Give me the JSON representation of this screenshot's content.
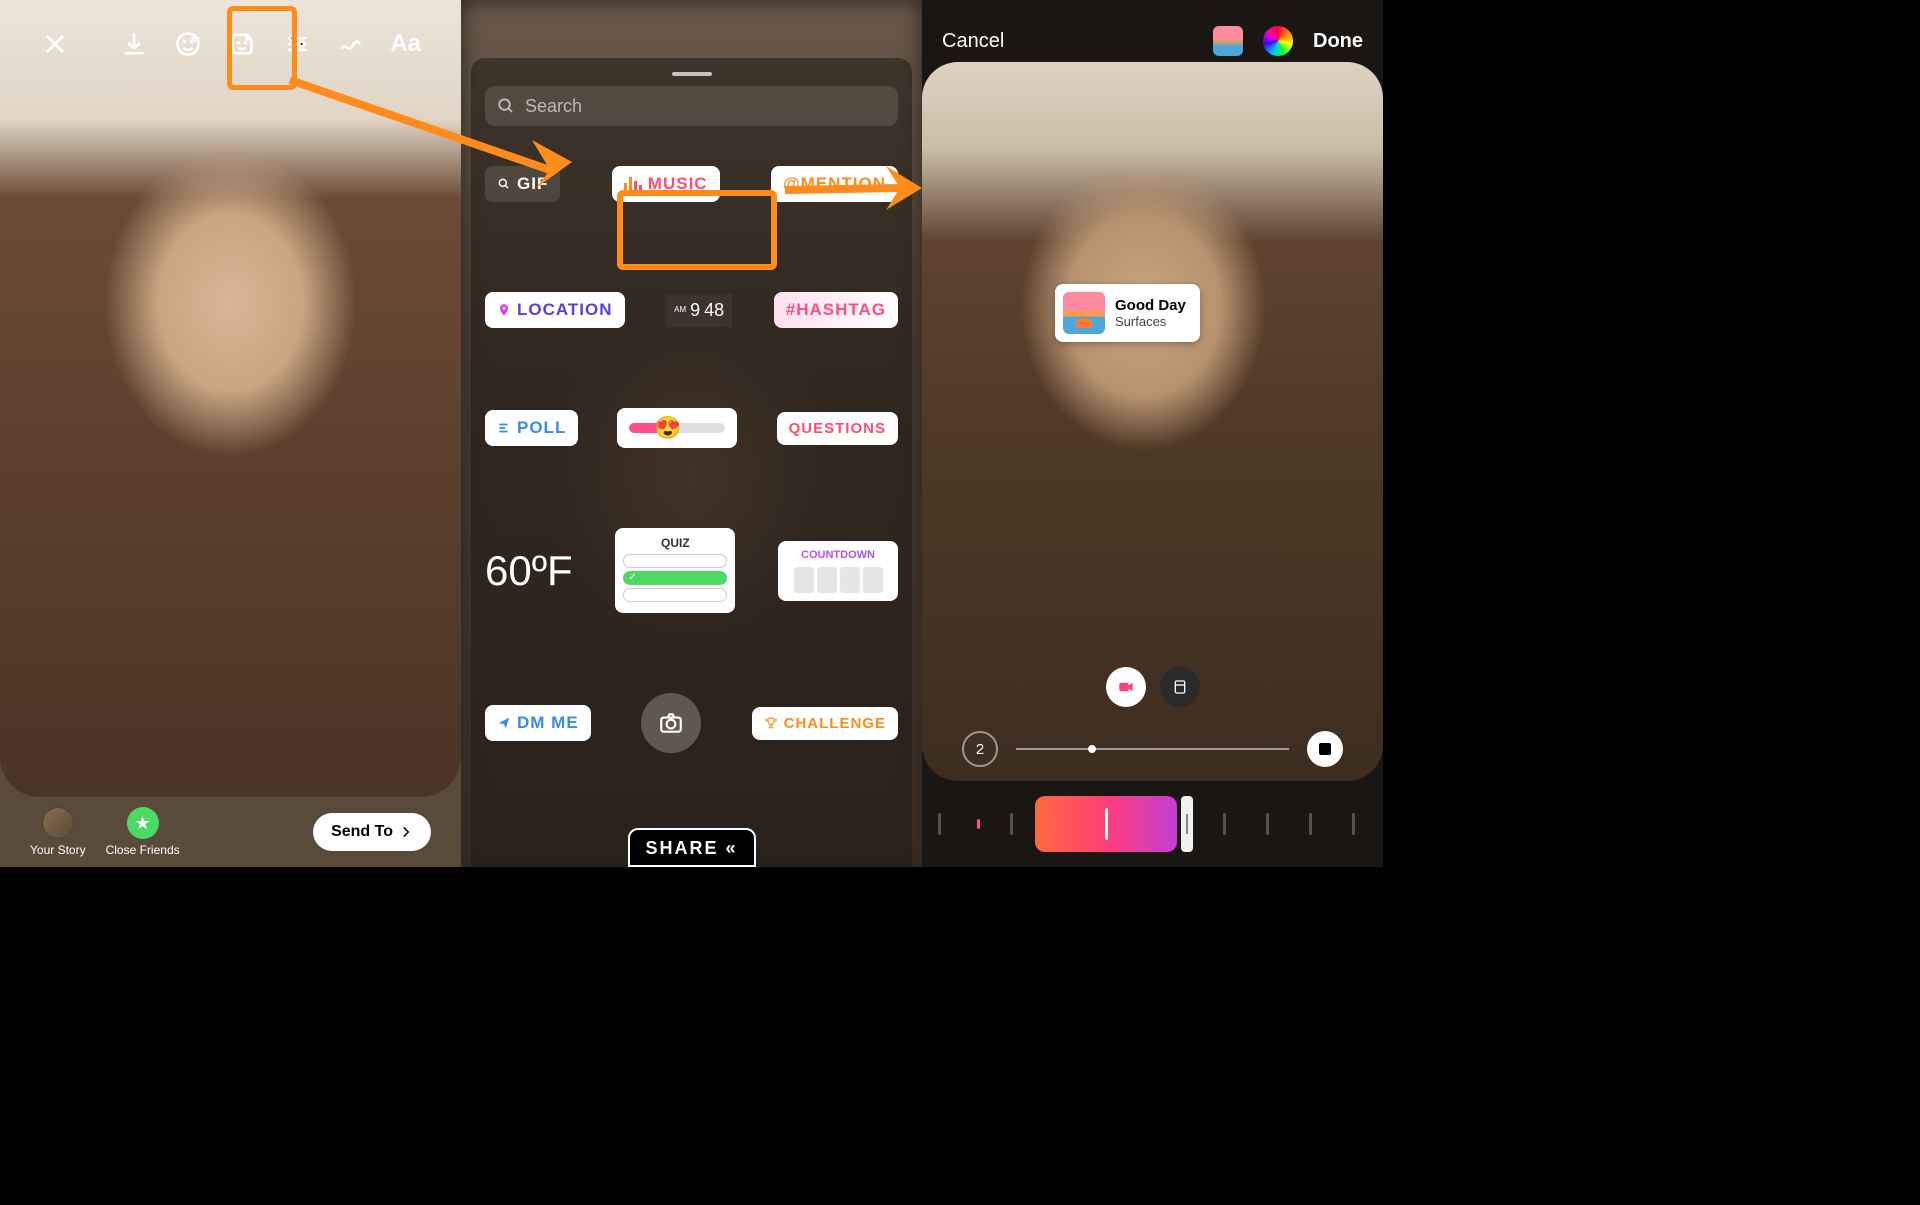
{
  "screen1": {
    "toolbar_icons": [
      "close",
      "download",
      "sparkle",
      "sticker",
      "sliders",
      "draw",
      "text"
    ],
    "text_tool": "Aa",
    "your_story": "Your Story",
    "close_friends": "Close Friends",
    "send_to": "Send To"
  },
  "screen2": {
    "search_placeholder": "Search",
    "stickers": {
      "gif": "GIF",
      "music": "MUSIC",
      "mention": "@MENTION",
      "location": "LOCATION",
      "time": {
        "hh": "9",
        "mm": "48",
        "ampm": "AM"
      },
      "hashtag": "#HASHTAG",
      "poll": "POLL",
      "questions": "QUESTIONS",
      "temp": "60ºF",
      "quiz": "QUIZ",
      "countdown": "COUNTDOWN",
      "dmme": "DM ME",
      "challenge": "CHALLENGE"
    },
    "share": "SHARE «"
  },
  "screen3": {
    "cancel": "Cancel",
    "done": "Done",
    "song_title": "Good Day",
    "song_artist": "Surfaces",
    "scrub_count": "2"
  }
}
